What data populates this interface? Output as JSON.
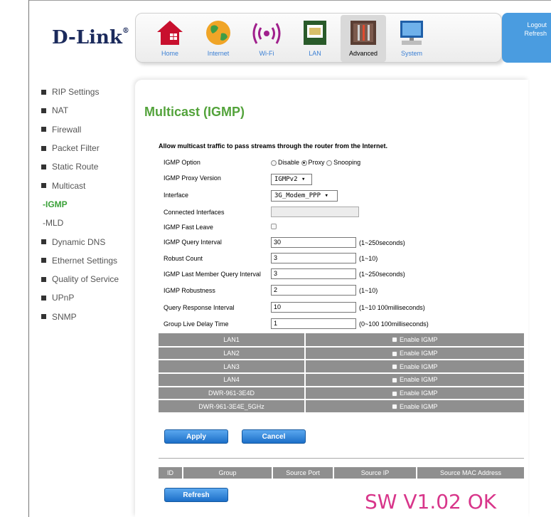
{
  "brand": {
    "logo": "D-Link",
    "logo_mark": "®"
  },
  "nav": [
    {
      "label": "Home",
      "icon": "home-icon"
    },
    {
      "label": "Internet",
      "icon": "globe-icon"
    },
    {
      "label": "Wi-Fi",
      "icon": "wifi-icon"
    },
    {
      "label": "LAN",
      "icon": "lan-icon"
    },
    {
      "label": "Advanced",
      "icon": "tools-icon"
    },
    {
      "label": "System",
      "icon": "computer-icon"
    }
  ],
  "side_buttons": {
    "logout": "Logout",
    "refresh": "Refresh"
  },
  "sidebar": [
    "RIP Settings",
    "NAT",
    "Firewall",
    "Packet Filter",
    "Static Route",
    "Multicast",
    "-IGMP",
    "-MLD",
    "Dynamic DNS",
    "Ethernet Settings",
    "Quality of Service",
    "UPnP",
    "SNMP"
  ],
  "page": {
    "title": "Multicast (IGMP)",
    "description": "Allow multicast traffic to pass streams through the router from the Internet."
  },
  "form": {
    "igmp_option": {
      "label": "IGMP Option",
      "options": [
        "Disable",
        "Proxy",
        "Snooping"
      ],
      "selected": "Proxy"
    },
    "proxy_version": {
      "label": "IGMP Proxy Version",
      "value": "IGMPv2"
    },
    "interface": {
      "label": "Interface",
      "value": "3G_Modem_PPP"
    },
    "connected_interfaces": {
      "label": "Connected Interfaces",
      "value": ""
    },
    "fast_leave": {
      "label": "IGMP Fast Leave"
    },
    "query_interval": {
      "label": "IGMP Query Interval",
      "value": "30",
      "hint": "(1~250seconds)"
    },
    "robust_count": {
      "label": "Robust Count",
      "value": "3",
      "hint": "(1~10)"
    },
    "last_member": {
      "label": "IGMP Last Member Query Interval",
      "value": "3",
      "hint": "(1~250seconds)"
    },
    "robustness": {
      "label": "IGMP Robustness",
      "value": "2",
      "hint": "(1~10)"
    },
    "response_interval": {
      "label": "Query Response Interval",
      "value": "10",
      "hint": "(1~10 100milliseconds)"
    },
    "group_live": {
      "label": "Group Live Delay Time",
      "value": "1",
      "hint": "(0~100 100milliseconds)"
    }
  },
  "lan_rows": [
    {
      "name": "LAN1",
      "enable": "Enable IGMP"
    },
    {
      "name": "LAN2",
      "enable": "Enable IGMP"
    },
    {
      "name": "LAN3",
      "enable": "Enable IGMP"
    },
    {
      "name": "LAN4",
      "enable": "Enable IGMP"
    },
    {
      "name": "DWR-961-3E4D",
      "enable": "Enable IGMP"
    },
    {
      "name": "DWR-961-3E4E_5GHz",
      "enable": "Enable IGMP"
    }
  ],
  "buttons": {
    "apply": "Apply",
    "cancel": "Cancel",
    "refresh": "Refresh"
  },
  "group_table": {
    "headers": [
      "ID",
      "Group",
      "Source Port",
      "Source IP",
      "Source MAC Address"
    ]
  },
  "watermark": "SW V1.02 OK"
}
